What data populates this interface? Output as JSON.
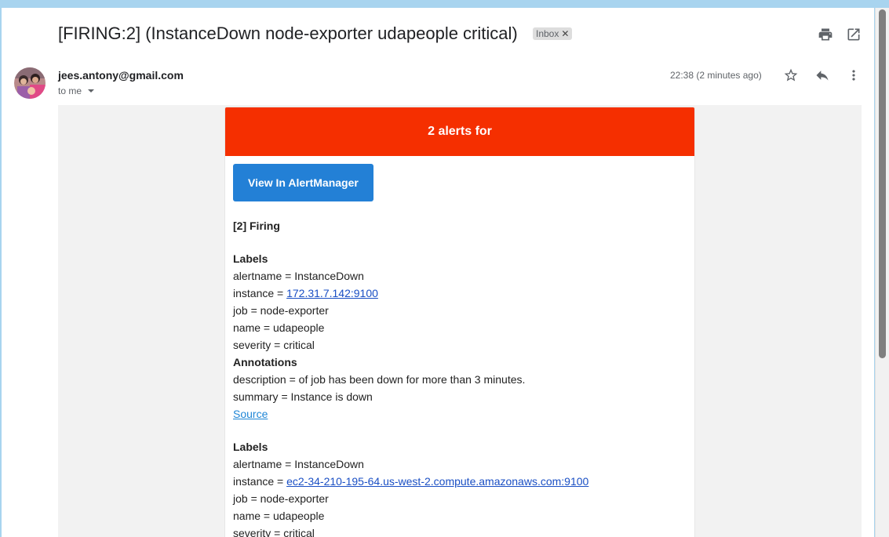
{
  "email": {
    "subject": "[FIRING:2] (InstanceDown node-exporter udapeople critical)",
    "label_chip": "Inbox",
    "sender": "jees.antony@gmail.com",
    "recipient": "to me",
    "timestamp": "22:38 (2 minutes ago)"
  },
  "toolbar_icons": [
    "print-icon",
    "open-in-new-window-icon",
    "star-icon",
    "reply-icon",
    "more-vert-icon"
  ],
  "alert": {
    "header": "2 alerts for",
    "button": "View In AlertManager",
    "firing_title": "[2] Firing",
    "labels_heading": "Labels",
    "annotations_heading": "Annotations",
    "source_link": "Source",
    "alerts": [
      {
        "alertname": "alertname = InstanceDown",
        "instance_prefix": "instance = ",
        "instance_link": "172.31.7.142:9100",
        "job": "job = node-exporter",
        "name": "name = udapeople",
        "severity": "severity = critical",
        "description": "description = of job has been down for more than 3 minutes.",
        "summary": "summary = Instance is down"
      },
      {
        "alertname": "alertname = InstanceDown",
        "instance_prefix": "instance = ",
        "instance_link": "ec2-34-210-195-64.us-west-2.compute.amazonaws.com:9100",
        "job": "job = node-exporter",
        "name": "name = udapeople",
        "severity": "severity = critical"
      }
    ]
  },
  "colors": {
    "alert_header": "#f52f00",
    "button": "#2380d6",
    "link": "#1a4fc4"
  }
}
